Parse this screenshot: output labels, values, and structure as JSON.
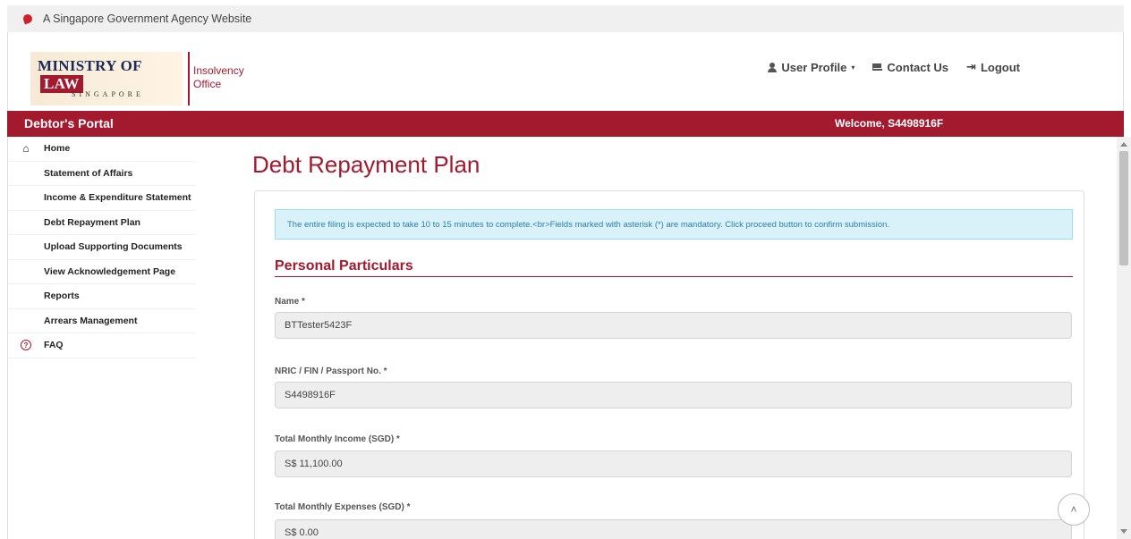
{
  "gov_banner": {
    "text": "A Singapore Government Agency Website"
  },
  "logo": {
    "ministry": "MINISTRY OF",
    "law": "LAW",
    "country": "SINGAPORE",
    "office_line1": "Insolvency",
    "office_line2": "Office"
  },
  "topnav": {
    "user_profile": "User Profile",
    "contact": "Contact Us",
    "logout": "Logout"
  },
  "portal_bar": {
    "title": "Debtor's Portal",
    "welcome": "Welcome, S4498916F"
  },
  "sidebar": {
    "items": [
      {
        "label": "Home",
        "icon": "home-icon"
      },
      {
        "label": "Statement of Affairs",
        "icon": "document-icon"
      },
      {
        "label": "Income & Expenditure Statement",
        "icon": "document-icon"
      },
      {
        "label": "Debt Repayment Plan",
        "icon": "document-icon"
      },
      {
        "label": "Upload Supporting Documents",
        "icon": "cloud-upload-icon"
      },
      {
        "label": "View Acknowledgement Page",
        "icon": "document-icon"
      },
      {
        "label": "Reports",
        "icon": "document-icon"
      },
      {
        "label": "Arrears Management",
        "icon": "document-icon"
      },
      {
        "label": "FAQ",
        "icon": "question-circle-icon"
      }
    ]
  },
  "main": {
    "title": "Debt Repayment Plan",
    "alert": "The entire filing is expected to take 10 to 15 minutes to complete.<br>Fields marked with asterisk (*) are mandatory. Click proceed button to confirm submission.",
    "section_title": "Personal Particulars",
    "fields": [
      {
        "label": "Name *",
        "value": "BTTester5423F"
      },
      {
        "label": "NRIC / FIN / Passport No. *",
        "value": "S4498916F"
      },
      {
        "label": "Total Monthly Income (SGD) *",
        "value": "S$ 11,100.00"
      },
      {
        "label": "Total Monthly Expenses (SGD) *",
        "value": "S$ 0.00"
      }
    ]
  },
  "colors": {
    "brand": "#a3192e",
    "alert_bg": "#d9f2fa",
    "alert_text": "#2a7fa8"
  }
}
